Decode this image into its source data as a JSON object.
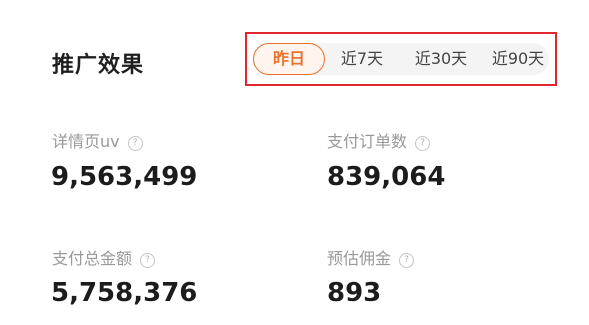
{
  "header": {
    "title": "推广效果"
  },
  "tabs": [
    {
      "label": "昨日",
      "active": true
    },
    {
      "label": "近7天",
      "active": false
    },
    {
      "label": "近30天",
      "active": false
    },
    {
      "label": "近90天",
      "active": false
    }
  ],
  "metrics": [
    {
      "label": "详情页uv",
      "value": "9,563,499",
      "help_icon": "question-circle-icon"
    },
    {
      "label": "支付订单数",
      "value": "839,064",
      "help_icon": "question-circle-icon"
    },
    {
      "label": "支付总金额",
      "value": "5,758,376",
      "help_icon": "question-circle-icon"
    },
    {
      "label": "预估佣金",
      "value": "893",
      "help_icon": "question-circle-icon"
    }
  ],
  "colors": {
    "accent": "#e8722e",
    "highlight_border": "#e0262f",
    "label_gray": "#999999",
    "value_dark": "#1c1c1c"
  }
}
